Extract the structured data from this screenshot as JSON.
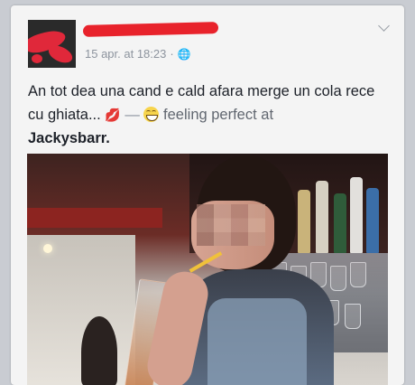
{
  "post": {
    "date": "15 apr. at 18:23",
    "separator": "·",
    "privacy_icon": "globe-icon",
    "status_text": "An tot dea  una cand e cald afara merge un cola rece cu ghiata...",
    "feeling_prefix": "—",
    "feeling_label": "feeling perfect at",
    "place": "Jackysbarr."
  },
  "icons": {
    "lips": "lips-emoji",
    "feeling": "grinning-emoji",
    "menu": "chevron-down-icon"
  },
  "colors": {
    "name_redaction": "#e8222b",
    "text": "#1d2129",
    "meta": "#8d949e"
  }
}
